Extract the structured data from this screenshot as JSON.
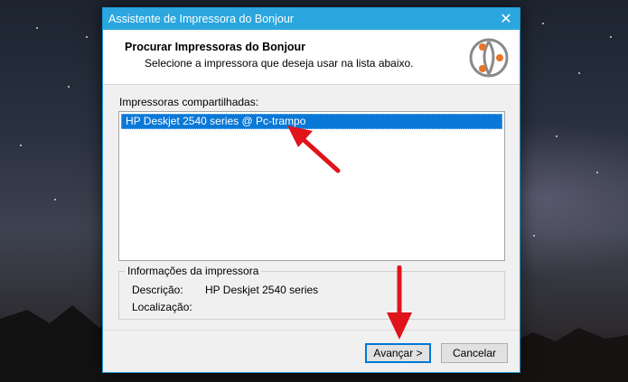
{
  "window": {
    "title": "Assistente de Impressora do Bonjour"
  },
  "header": {
    "title": "Procurar Impressoras do Bonjour",
    "subtitle": "Selecione a impressora que deseja usar na lista abaixo."
  },
  "printers": {
    "label": "Impressoras compartilhadas:",
    "items": [
      "HP Deskjet 2540 series @ Pc-trampo"
    ],
    "selected_index": 0
  },
  "info": {
    "legend": "Informações da impressora",
    "description_label": "Descrição:",
    "description_value": "HP Deskjet 2540 series",
    "location_label": "Localização:",
    "location_value": ""
  },
  "buttons": {
    "next": "Avançar >",
    "cancel": "Cancelar"
  },
  "colors": {
    "titlebar": "#2ba6de",
    "selection": "#0a78d7",
    "annotation_arrow": "#e0141b"
  }
}
